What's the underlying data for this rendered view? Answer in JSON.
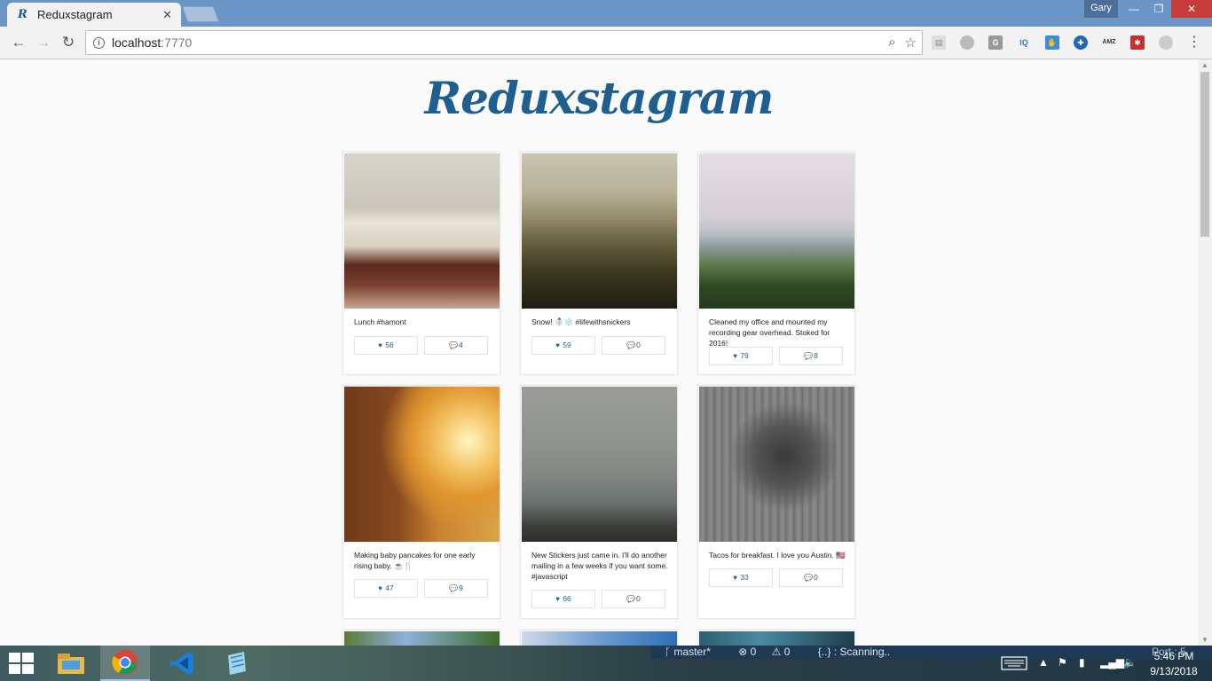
{
  "browser": {
    "tab_title": "Reduxstagram",
    "tab_favicon": "R",
    "url_host": "localhost",
    "url_port": ":7770",
    "user_name": "Gary"
  },
  "extensions": [
    "reader-icon",
    "circle-extension-icon",
    "G",
    "IQ",
    "hand-extension-icon",
    "crosshair-extension-icon",
    "AMZ",
    "red-extension-icon",
    "grey-circle-extension-icon"
  ],
  "app": {
    "logo": "Reduxstagram"
  },
  "posts": [
    {
      "caption": "Lunch #hamont",
      "likes": "56",
      "comments": "4",
      "image": "open-book-photo"
    },
    {
      "caption": "Snow! ☃️❄️ #lifewithsnickers",
      "likes": "59",
      "comments": "0",
      "image": "hazy-hills-photo"
    },
    {
      "caption": "Cleaned my office and mounted my recording gear overhead. Stoked for 2016!",
      "likes": "79",
      "comments": "8",
      "image": "coast-flowers-photo"
    },
    {
      "caption": "Making baby pancakes for one early rising baby. ☕️🍴",
      "likes": "47",
      "comments": "9",
      "image": "girl-sunlight-photo"
    },
    {
      "caption": "New Stickers just came in. I'll do another mailing in a few weeks if you want some. #javascript",
      "likes": "66",
      "comments": "0",
      "image": "foggy-beach-photo"
    },
    {
      "caption": "Tacos for breakfast. I love you Austin. 🇺🇸",
      "likes": "33",
      "comments": "0",
      "image": "pinecones-photo"
    }
  ],
  "icons": {
    "like": "♥",
    "comment": "💬"
  },
  "taskbar": {
    "git_branch": "master*",
    "errors": "0",
    "warnings": "0",
    "scanning": "{..} : Scanning..",
    "time": "5:46 PM",
    "date": "9/13/2018",
    "overflow_text": "Port : 5"
  }
}
